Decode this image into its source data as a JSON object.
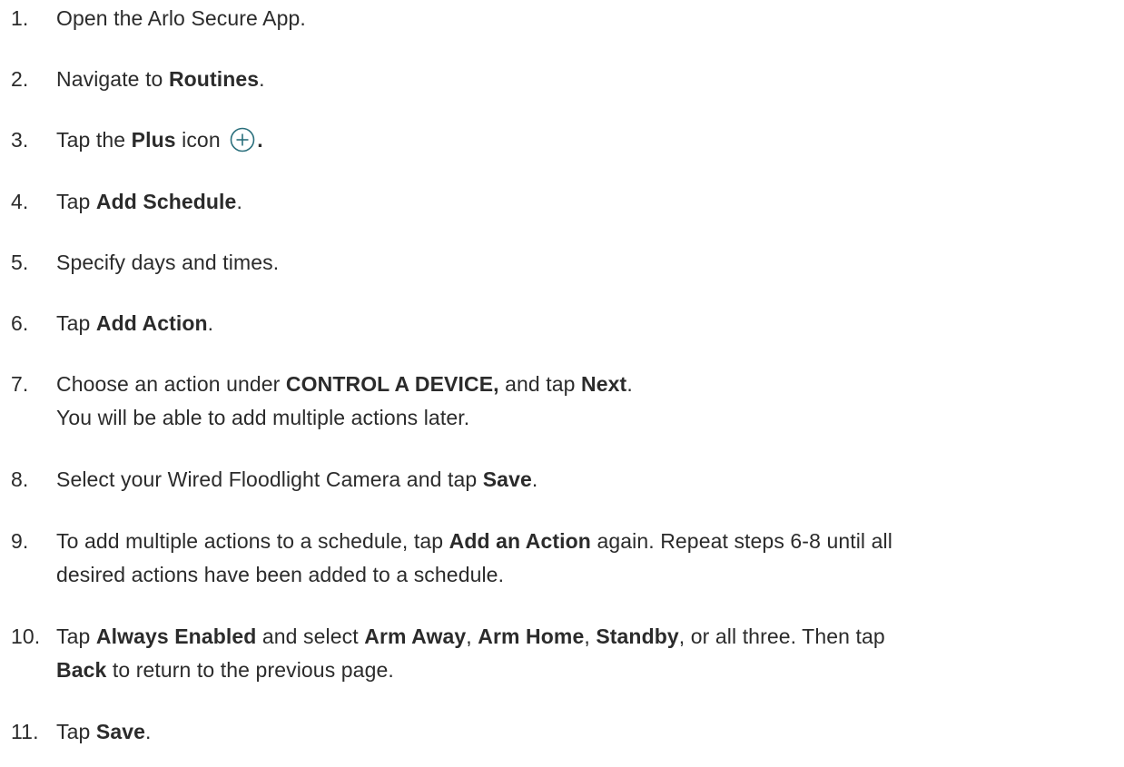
{
  "steps": [
    {
      "num": "1.",
      "parts": [
        "Open the Arlo Secure App."
      ]
    },
    {
      "num": "2.",
      "parts": [
        "Navigate to ",
        "Routines",
        "."
      ]
    },
    {
      "num": "3.",
      "parts": [
        "Tap the ",
        "Plus",
        " icon ",
        "."
      ],
      "icon": "plus-circle-icon"
    },
    {
      "num": "4.",
      "parts": [
        "Tap ",
        "Add Schedule",
        "."
      ]
    },
    {
      "num": "5.",
      "parts": [
        "Specify days and times."
      ]
    },
    {
      "num": "6.",
      "parts": [
        "Tap ",
        "Add Action",
        "."
      ]
    },
    {
      "num": "7.",
      "parts": [
        "Choose an action under ",
        "CONTROL A DEVICE,",
        " and tap ",
        "Next",
        "."
      ],
      "note": "You will be able to add multiple actions later."
    },
    {
      "num": "8.",
      "parts": [
        "Select your Wired Floodlight Camera and tap ",
        "Save",
        "."
      ]
    },
    {
      "num": "9.",
      "parts": [
        "To add multiple actions to a schedule, tap ",
        "Add an Action",
        " again. Repeat steps 6-8 until all"
      ],
      "cont": [
        "desired actions have been added to a schedule."
      ]
    },
    {
      "num": "10.",
      "parts": [
        "Tap ",
        "Always Enabled",
        " and select ",
        "Arm Away",
        ", ",
        "Arm Home",
        ", ",
        "Standby",
        ", or all three. Then tap"
      ],
      "cont": [
        "Back",
        " to return to the previous page."
      ]
    },
    {
      "num": "11.",
      "parts": [
        "Tap ",
        "Save",
        "."
      ]
    }
  ]
}
